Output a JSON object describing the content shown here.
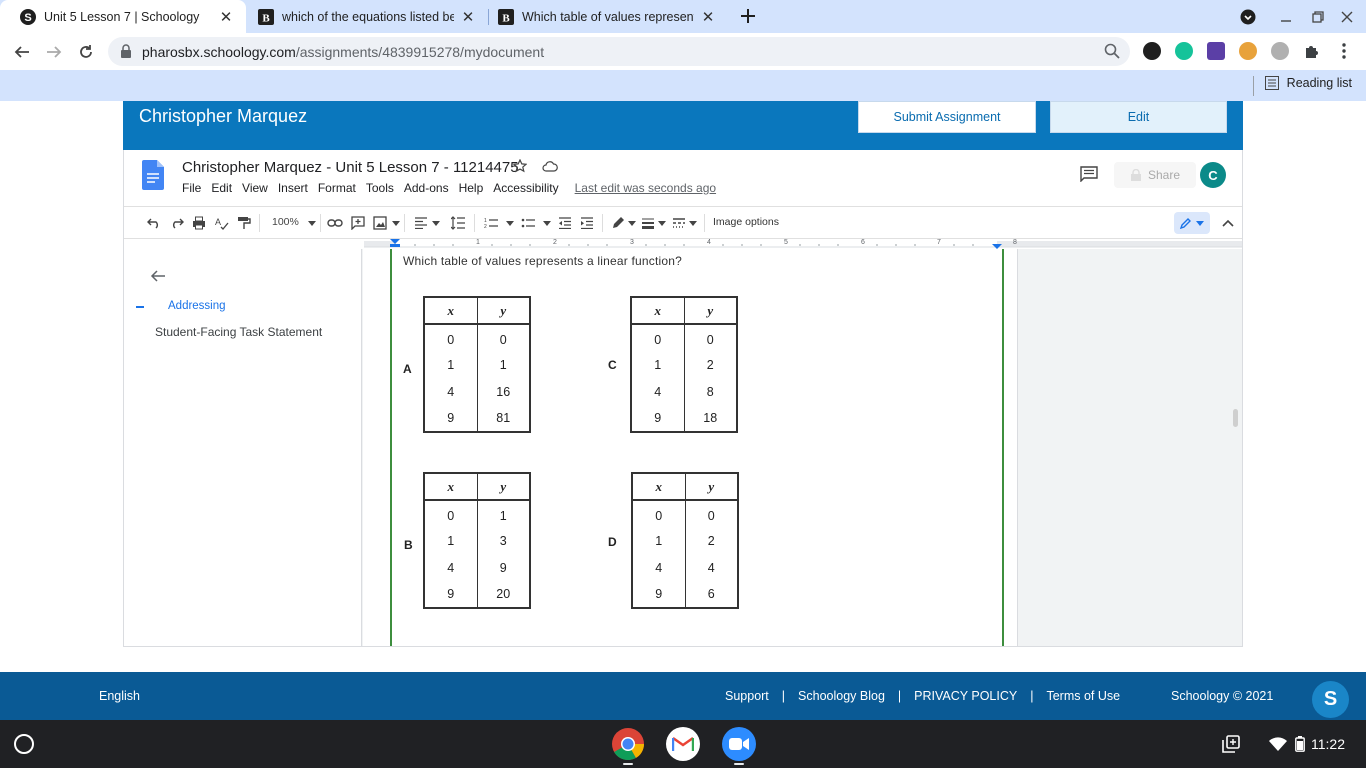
{
  "browser": {
    "tabs": [
      {
        "title": "Unit 5 Lesson 7 | Schoology",
        "favicon": "schoology-icon"
      },
      {
        "title": "which of the equations listed bel",
        "favicon": "brainly-icon"
      },
      {
        "title": "Which table of values represents",
        "favicon": "brainly-icon"
      }
    ],
    "url_domain": "pharosbx.schoology.com",
    "url_path": "/assignments/4839915278/mydocument",
    "reading_list_label": "Reading list"
  },
  "schoology": {
    "student_name": "Christopher Marquez",
    "submit_label": "Submit Assignment",
    "edit_label": "Edit"
  },
  "docs": {
    "title": "Christopher Marquez - Unit 5 Lesson 7 - 11214475",
    "menu": [
      "File",
      "Edit",
      "View",
      "Insert",
      "Format",
      "Tools",
      "Add-ons",
      "Help",
      "Accessibility"
    ],
    "last_edit": "Last edit was seconds ago",
    "share_label": "Share",
    "account_initial": "C",
    "zoom": "100%",
    "image_options": "Image options",
    "ruler_numbers": [
      "1",
      "2",
      "3",
      "4",
      "5",
      "6",
      "7",
      "8"
    ],
    "outline": {
      "item1": "Addressing",
      "item2": "Student-Facing Task Statement"
    },
    "question": "Which table of values represents a linear function?",
    "tables": [
      {
        "label": "A",
        "x_header": "x",
        "y_header": "y",
        "rows": [
          [
            "0",
            "0"
          ],
          [
            "1",
            "1"
          ],
          [
            "4",
            "16"
          ],
          [
            "9",
            "81"
          ]
        ]
      },
      {
        "label": "C",
        "x_header": "x",
        "y_header": "y",
        "rows": [
          [
            "0",
            "0"
          ],
          [
            "1",
            "2"
          ],
          [
            "4",
            "8"
          ],
          [
            "9",
            "18"
          ]
        ]
      },
      {
        "label": "B",
        "x_header": "x",
        "y_header": "y",
        "rows": [
          [
            "0",
            "1"
          ],
          [
            "1",
            "3"
          ],
          [
            "4",
            "9"
          ],
          [
            "9",
            "20"
          ]
        ]
      },
      {
        "label": "D",
        "x_header": "x",
        "y_header": "y",
        "rows": [
          [
            "0",
            "0"
          ],
          [
            "1",
            "2"
          ],
          [
            "4",
            "4"
          ],
          [
            "9",
            "6"
          ]
        ]
      }
    ]
  },
  "footer": {
    "language": "English",
    "links": [
      "Support",
      "Schoology Blog",
      "PRIVACY POLICY",
      "Terms of Use"
    ],
    "separator": "|",
    "copyright": "Schoology © 2021",
    "badge": "S"
  },
  "shelf": {
    "clock": "11:22"
  },
  "colors": {
    "schoology_blue": "#0a77bd",
    "footer_blue": "#0a5a95",
    "tabbar": "#d3e3fd",
    "docs_blue": "#1a73e8",
    "margin_green": "#3e8e3e"
  }
}
